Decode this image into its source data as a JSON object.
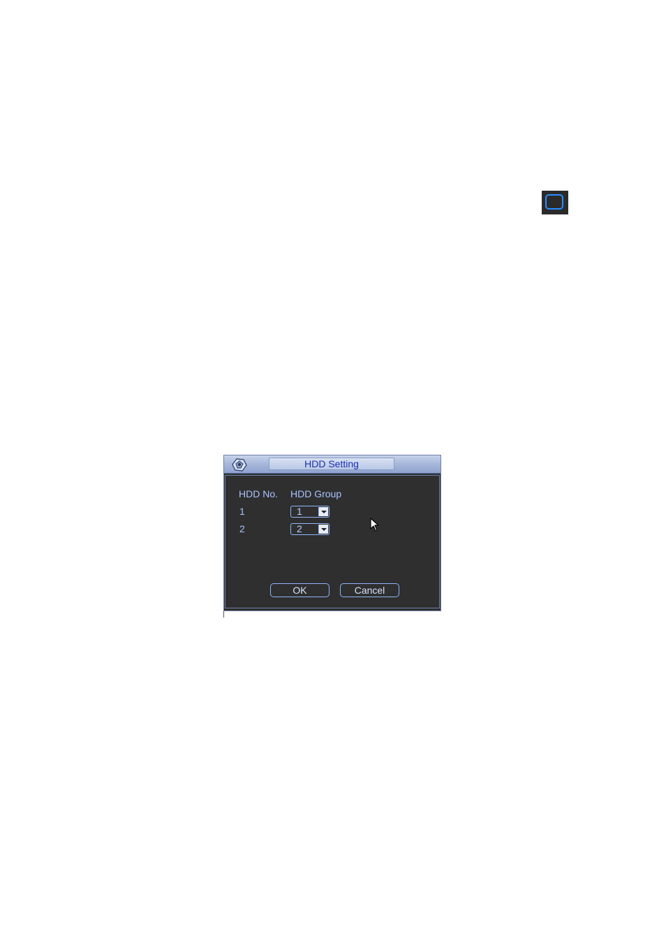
{
  "dialog": {
    "title": "HDD Setting",
    "columns": {
      "hdd_no": "HDD No.",
      "hdd_group": "HDD Group"
    },
    "rows": [
      {
        "hdd_no": "1",
        "hdd_group": "1"
      },
      {
        "hdd_no": "2",
        "hdd_group": "2"
      }
    ],
    "buttons": {
      "ok": "OK",
      "cancel": "Cancel"
    }
  },
  "colors": {
    "dialog_bg": "#2f2f2f",
    "label_text": "#a9c4ff",
    "title_text": "#1c2fb0",
    "accent_border": "#8fb6ff",
    "icon_accent": "#2a8cff"
  },
  "icons": {
    "top_square": "rounded-square-icon",
    "title_logo": "gear-logo-icon",
    "cursor": "mouse-pointer-icon",
    "dropdown": "chevron-down-icon"
  }
}
